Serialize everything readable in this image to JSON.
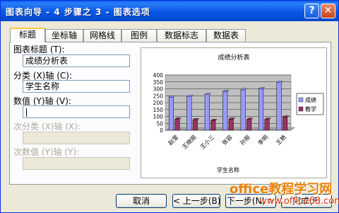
{
  "window": {
    "title": "图表向导 - 4 步骤之 3 - 图表选项",
    "help_glyph": "?",
    "close_glyph": "✕"
  },
  "tabs": [
    {
      "label": "标题",
      "active": true
    },
    {
      "label": "坐标轴",
      "active": false
    },
    {
      "label": "网格线",
      "active": false
    },
    {
      "label": "图例",
      "active": false
    },
    {
      "label": "数据标志",
      "active": false
    },
    {
      "label": "数据表",
      "active": false
    }
  ],
  "form": {
    "chart_title_label": "图表标题 (T):",
    "chart_title_value": "成绩分析表",
    "category_x_label": "分类 (X)轴 (C):",
    "category_x_value": "学生名称",
    "value_y_label": "数值 (Y)轴 (V):",
    "value_y_value": "",
    "secondary_x_label": "次分类 (X)轴 (X):",
    "secondary_y_label": "次数值 (Y)轴 (Y):"
  },
  "chart_data": {
    "type": "bar",
    "title": "成绩分析表",
    "xlabel": "学生名称",
    "ylabel": "",
    "ylim": [
      0,
      400
    ],
    "yticks": [
      "0",
      "50",
      "100",
      "150",
      "200",
      "250",
      "300",
      "350",
      "400"
    ],
    "categories": [
      "赵莹",
      "王晓丽",
      "王小三",
      "张容",
      "孙丽",
      "李明",
      "王艳"
    ],
    "series": [
      {
        "name": "成绩",
        "color": "#9999ff",
        "values": [
          240,
          245,
          258,
          280,
          293,
          300,
          345
        ]
      },
      {
        "name": "教学",
        "color": "#993366",
        "values": [
          80,
          75,
          70,
          80,
          78,
          78,
          95
        ]
      }
    ],
    "plot_background": "#c0c0c0",
    "grid": true,
    "legend": "right"
  },
  "buttons": {
    "cancel": "取消",
    "back": "< 上一步(B)",
    "next": "下一步(N) >",
    "finish": "完成(F)"
  },
  "watermark": {
    "line1": "office教程学习网",
    "line2": "www.office68.com"
  }
}
